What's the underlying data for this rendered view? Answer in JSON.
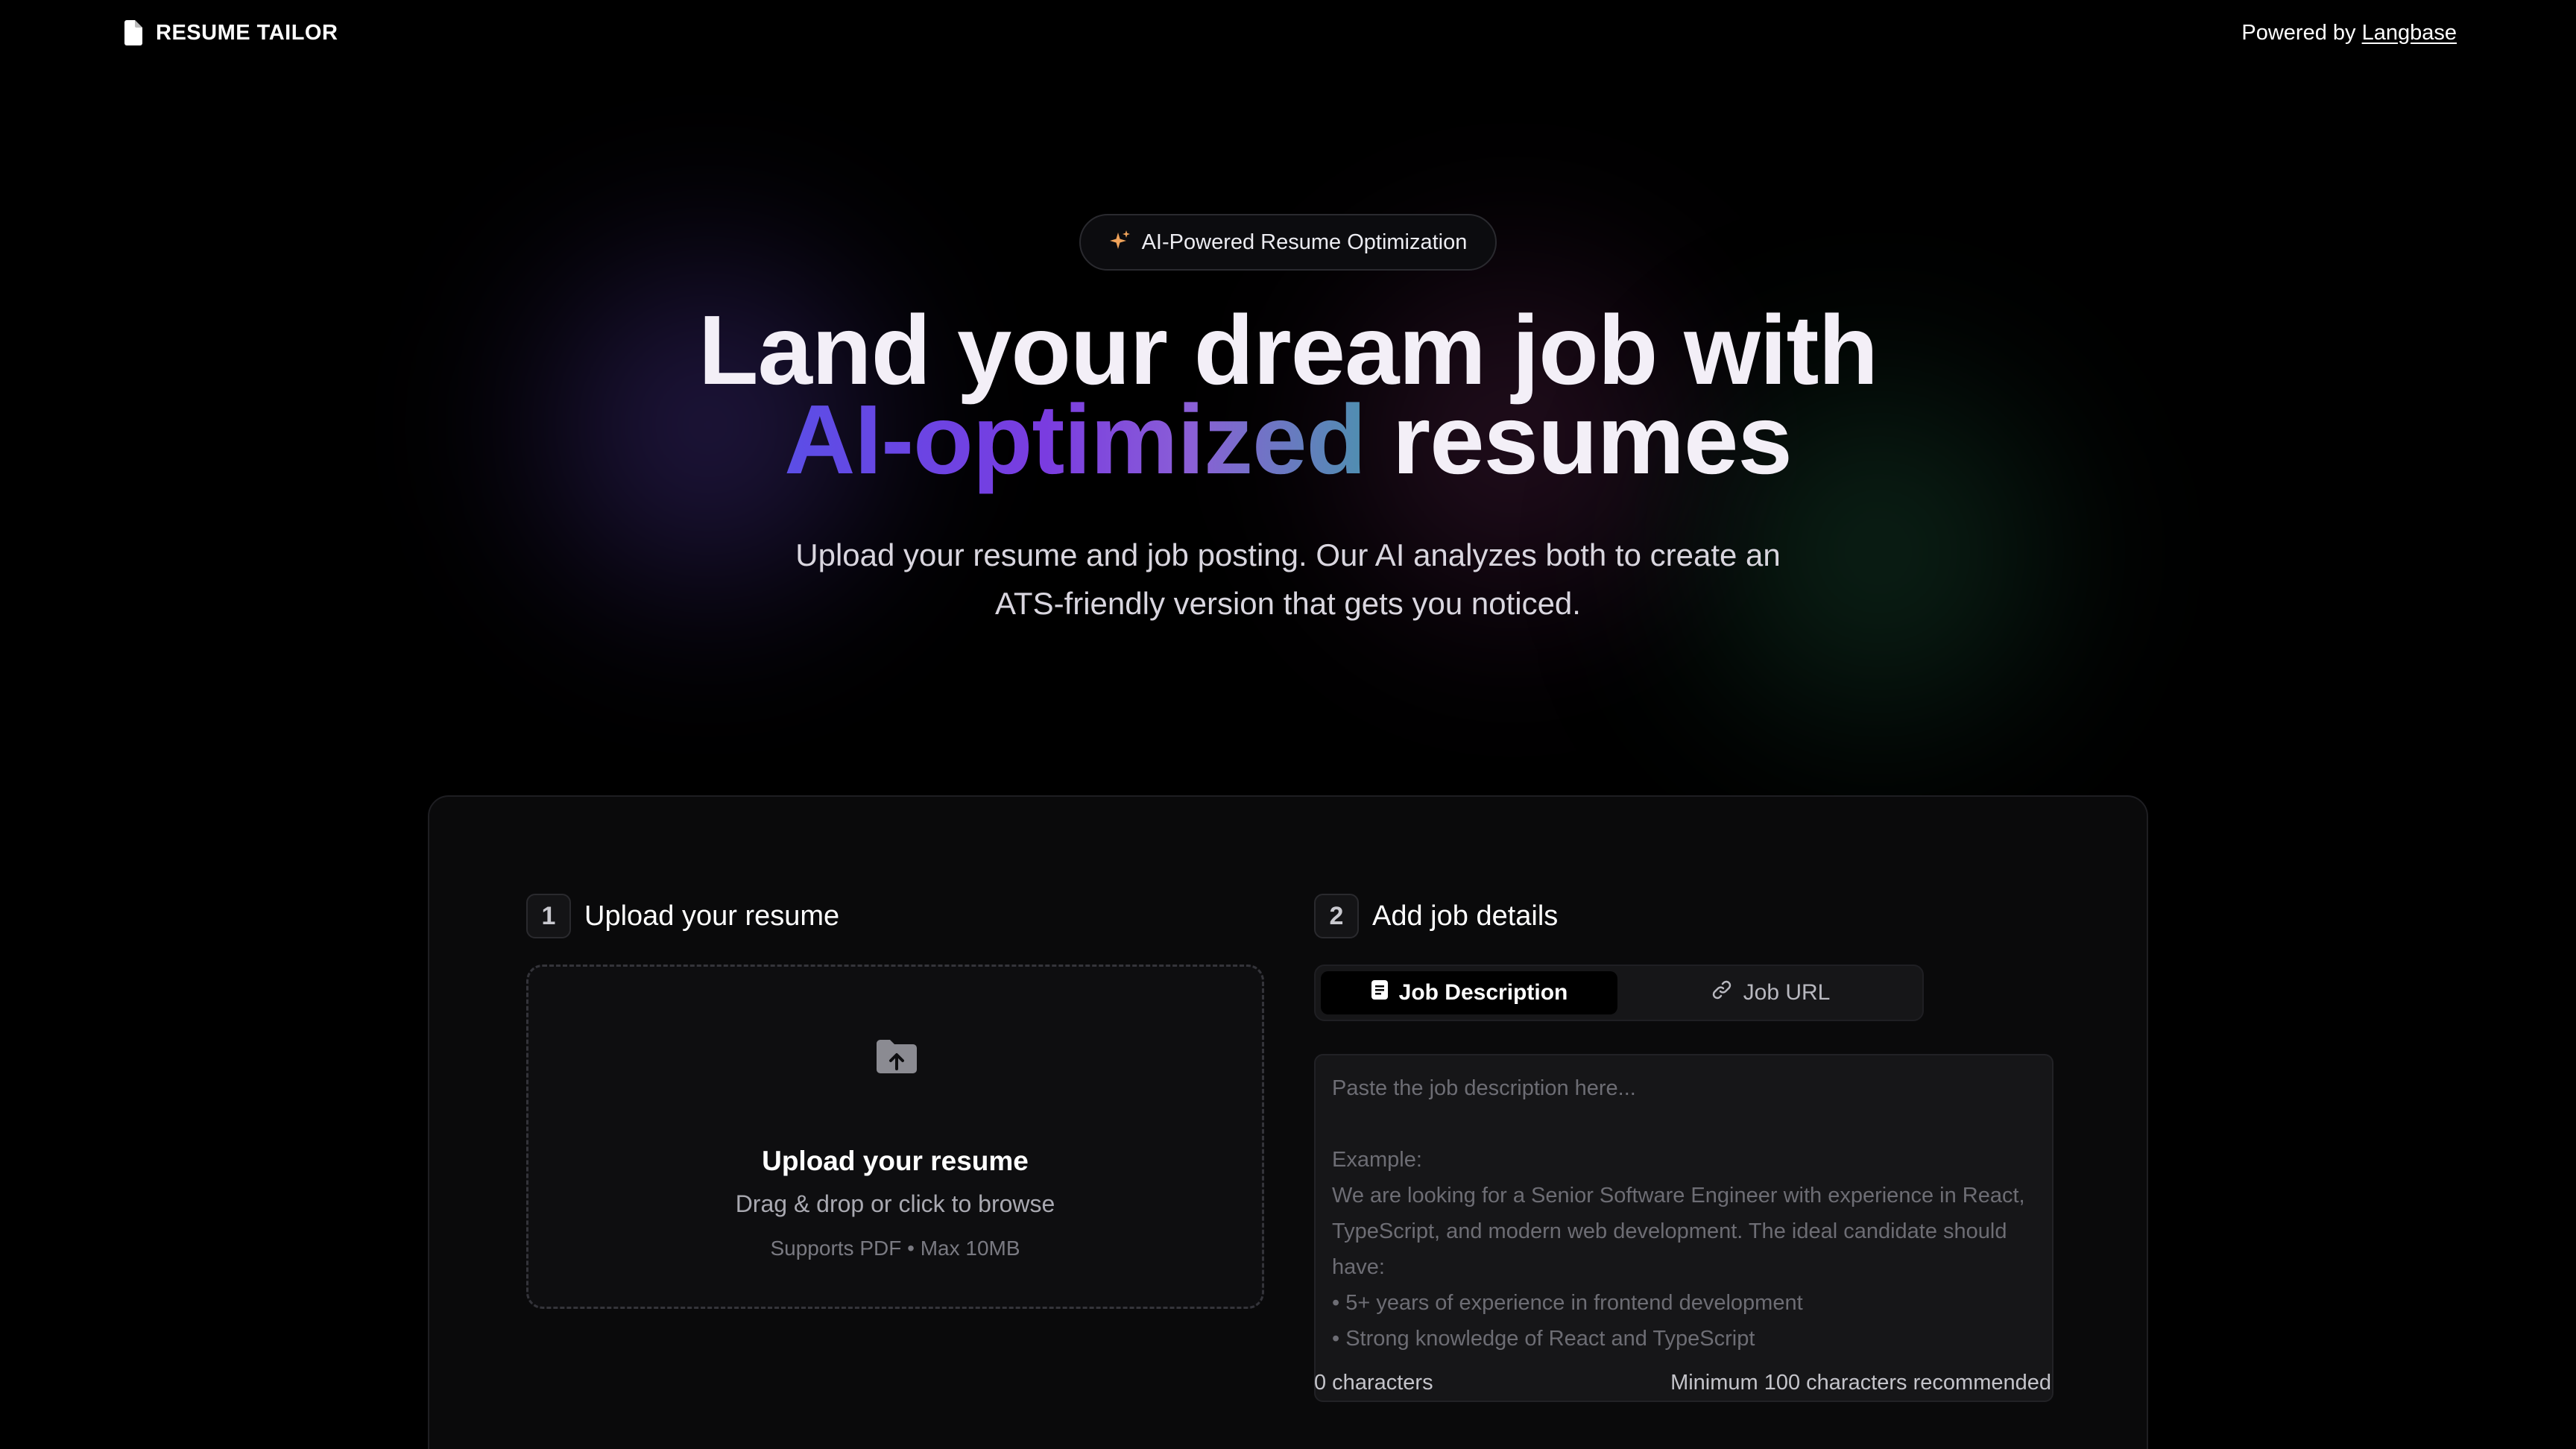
{
  "header": {
    "brand_name": "RESUME TAILOR",
    "powered_prefix": "Powered by",
    "powered_link": "Langbase"
  },
  "hero": {
    "badge_label": "AI-Powered Resume Optimization",
    "title_line1": "Land your dream job with",
    "title_highlight": "AI-optimized",
    "title_rest": " resumes",
    "subtitle_line1": "Upload your resume and job posting. Our AI analyzes both to create an",
    "subtitle_line2": "ATS-friendly version that gets you noticed."
  },
  "step1": {
    "number": "1",
    "title": "Upload your resume",
    "dropzone": {
      "title": "Upload your resume",
      "hint": "Drag & drop or click to browse",
      "note": "Supports PDF • Max 10MB"
    }
  },
  "step2": {
    "number": "2",
    "title": "Add job details",
    "tabs": [
      {
        "label": "Job Description",
        "active": true
      },
      {
        "label": "Job URL",
        "active": false
      }
    ],
    "textarea_placeholder": "Paste the job description here...\n\nExample:\nWe are looking for a Senior Software Engineer with experience in React, TypeScript, and modern web development. The ideal candidate should have:\n• 5+ years of experience in frontend development\n• Strong knowledge of React and TypeScript",
    "char_count": "0 characters",
    "min_note": "Minimum 100 characters recommended"
  },
  "colors": {
    "background": "#000000",
    "card": "#0a0a0b",
    "accent_badge_icon": "#f0a35a",
    "gradient_start": "#5b4ee6",
    "gradient_mid": "#7a3ce0",
    "gradient_end": "#4f8fb0"
  },
  "icons": {
    "brand": "document-icon",
    "badge": "sparkles-icon",
    "dropzone": "folder-upload-icon",
    "tab_desc": "document-text-icon",
    "tab_url": "link-icon"
  }
}
